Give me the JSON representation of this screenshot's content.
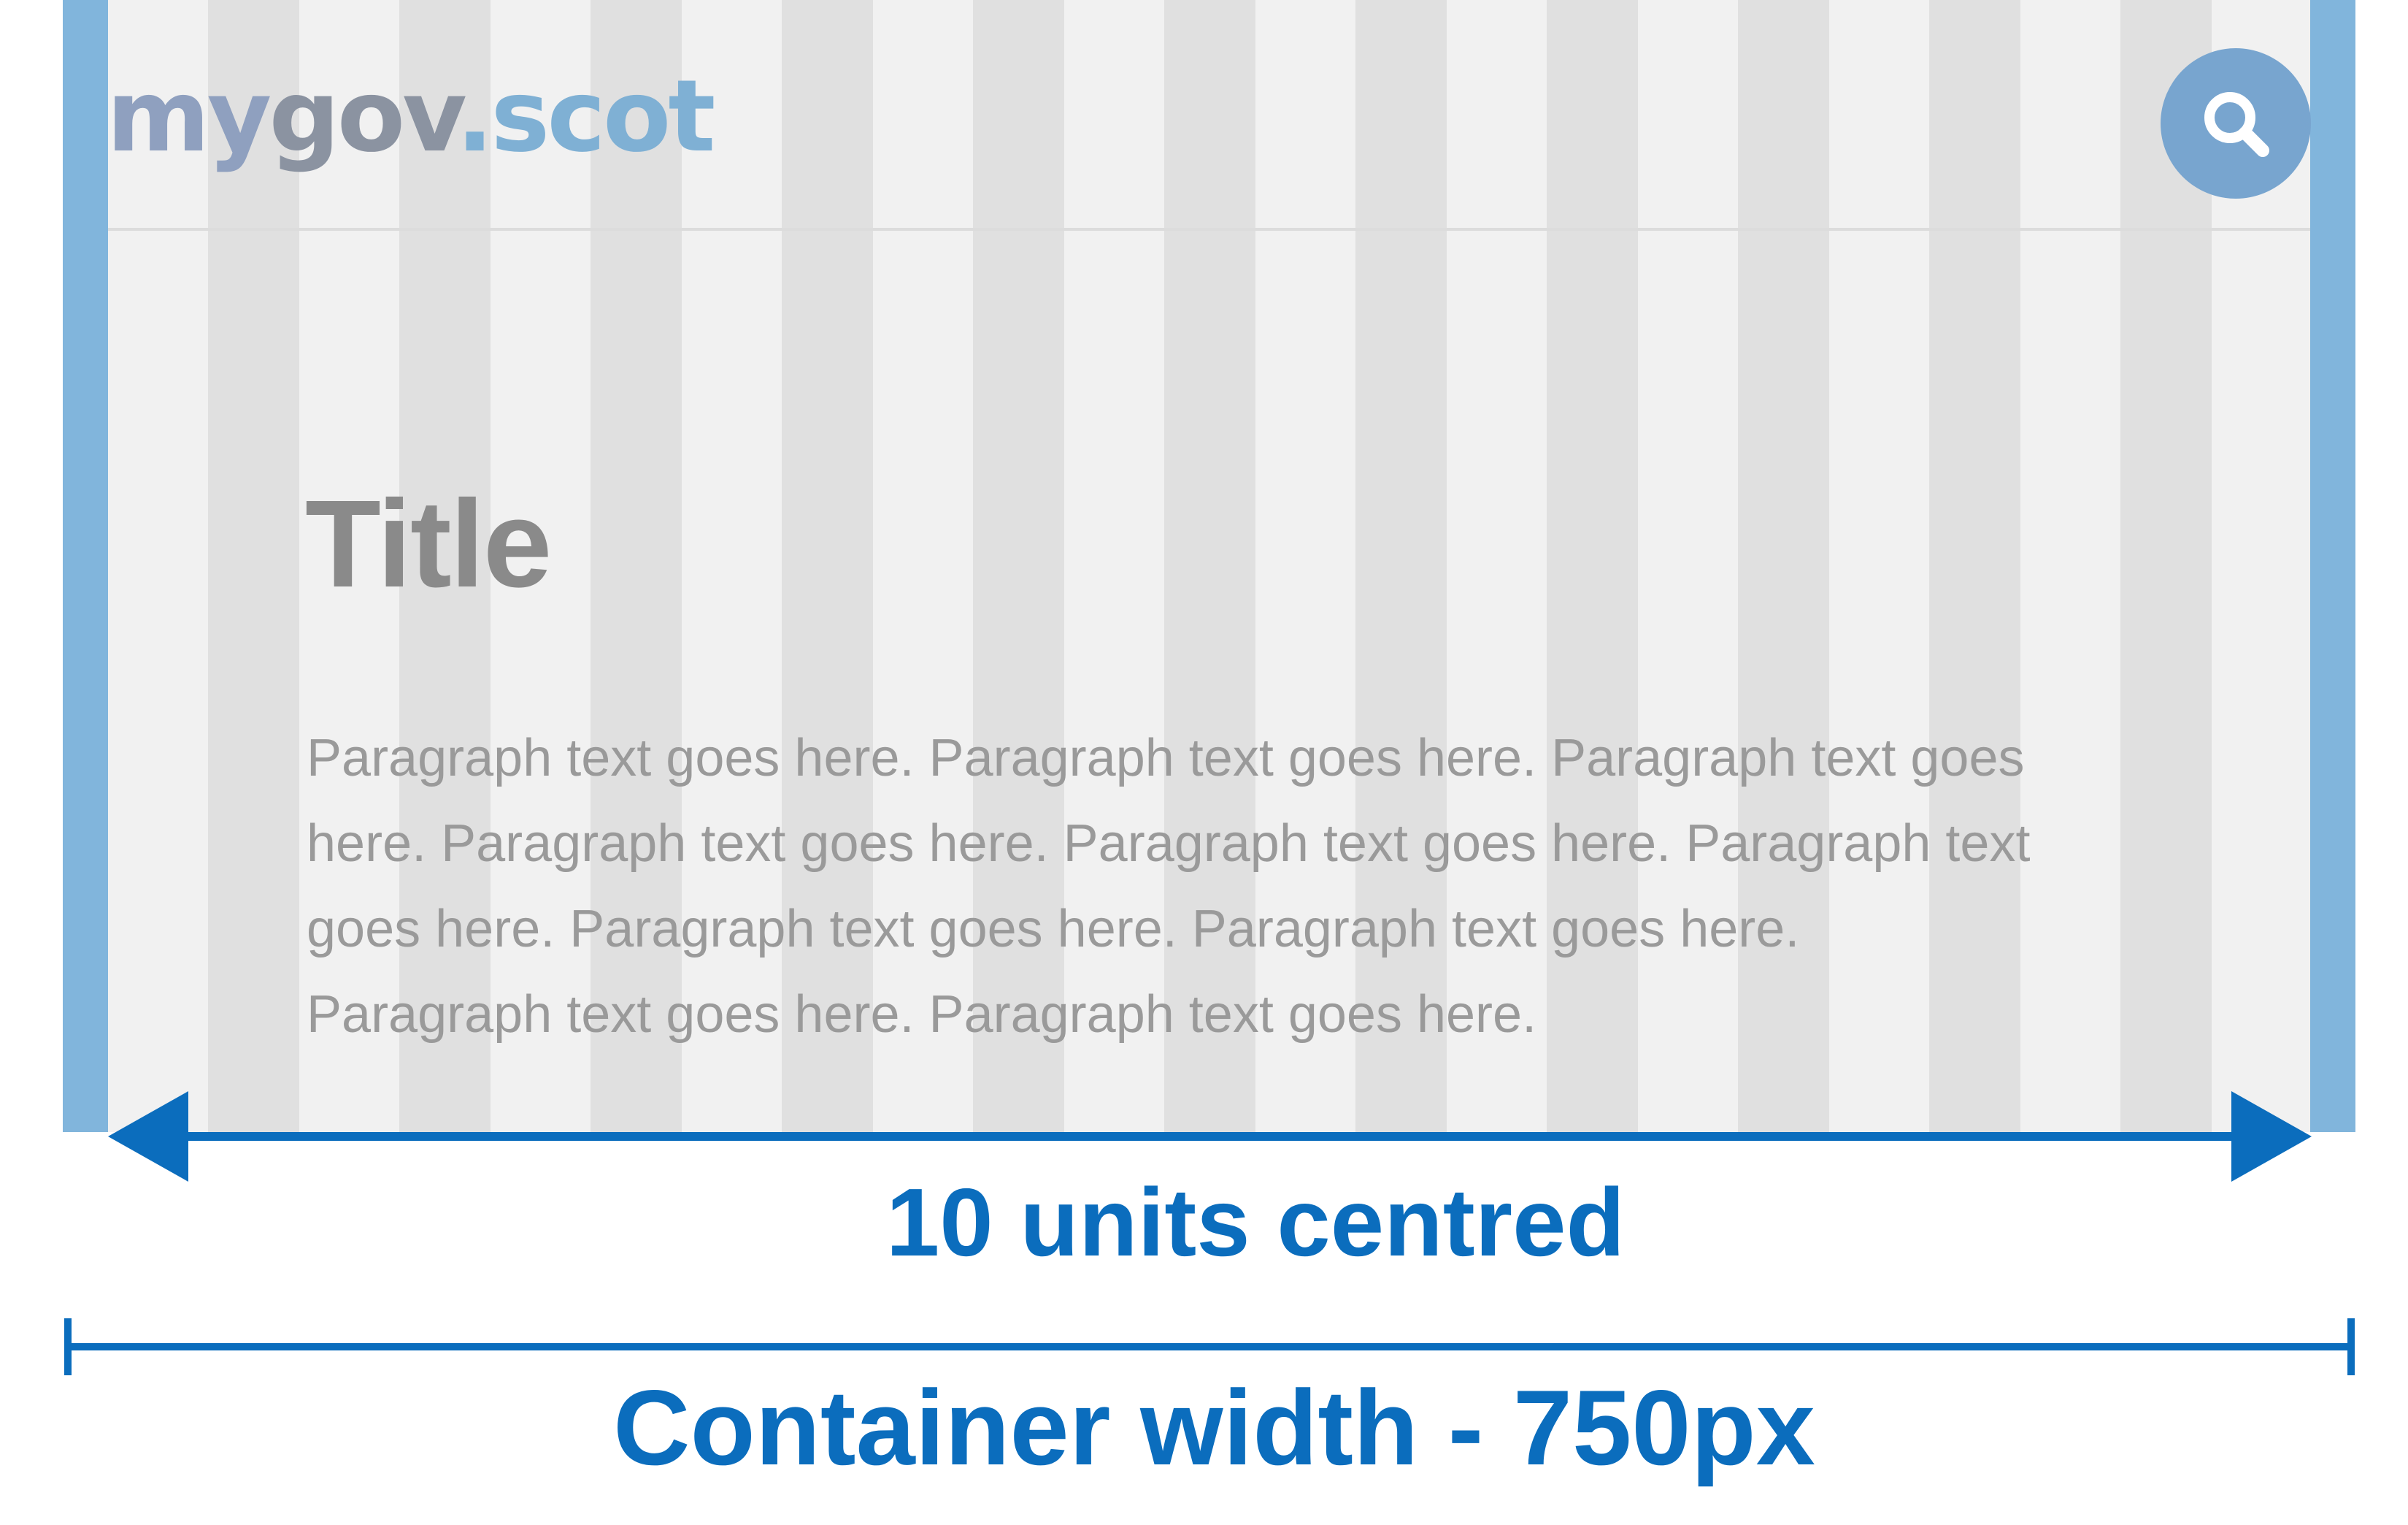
{
  "header": {
    "logo_parts": [
      "my",
      "gov",
      ".scot"
    ],
    "search_icon": "search-icon"
  },
  "content": {
    "title": "Title",
    "paragraph": "Paragraph text goes here. Paragraph text goes here. Paragraph text goes here. Paragraph text goes here. Paragraph text goes here. Paragraph text goes here. Paragraph text goes here. Paragraph text goes here. Paragraph text goes here. Paragraph text goes here."
  },
  "annotations": {
    "content_span_label": "10 units centred",
    "container_label": "Container width - 750px"
  },
  "colors": {
    "accent": "#0b6dbd",
    "gutter": "#81b5dc",
    "page_bg": "#f1f1f1",
    "column_stripe": "#e0e0e0"
  }
}
